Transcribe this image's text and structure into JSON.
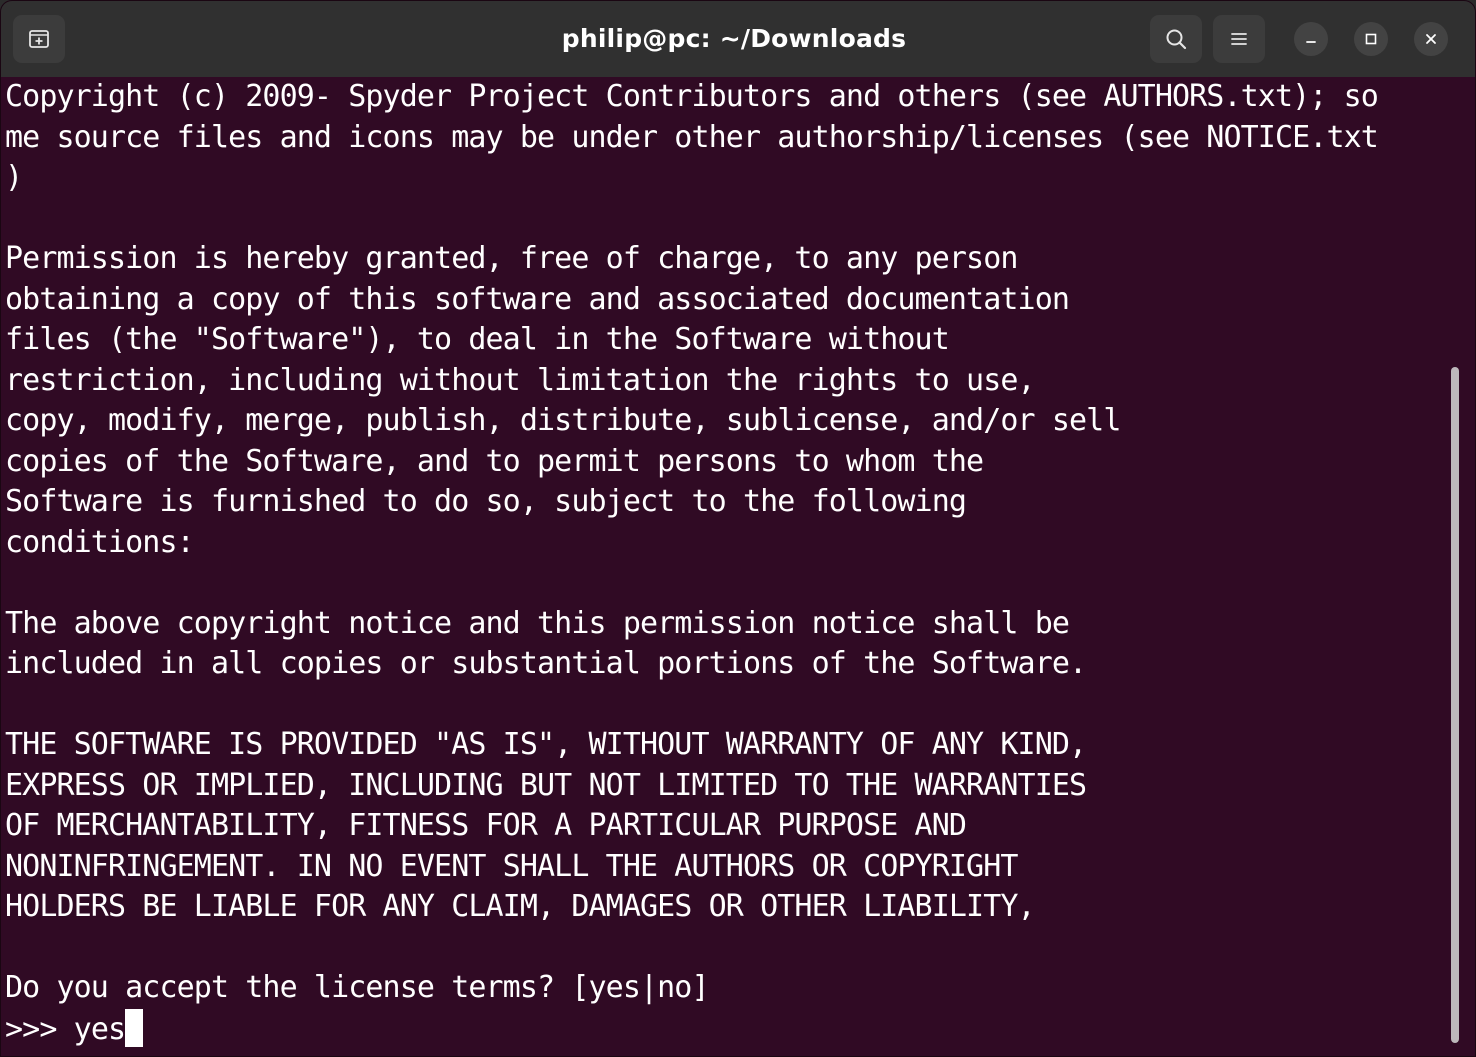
{
  "window": {
    "title": "philip@pc: ~/Downloads"
  },
  "titlebar": {
    "icons": {
      "new_tab": "new-tab-icon",
      "search": "search-icon",
      "menu": "hamburger-menu-icon",
      "minimize": "minimize-icon",
      "maximize": "maximize-icon",
      "close": "close-icon"
    }
  },
  "terminal": {
    "lines": [
      "Copyright (c) 2009- Spyder Project Contributors and others (see AUTHORS.txt); so",
      "me source files and icons may be under other authorship/licenses (see NOTICE.txt",
      ")",
      "",
      "Permission is hereby granted, free of charge, to any person",
      "obtaining a copy of this software and associated documentation",
      "files (the \"Software\"), to deal in the Software without",
      "restriction, including without limitation the rights to use,",
      "copy, modify, merge, publish, distribute, sublicense, and/or sell",
      "copies of the Software, and to permit persons to whom the",
      "Software is furnished to do so, subject to the following",
      "conditions:",
      "",
      "The above copyright notice and this permission notice shall be",
      "included in all copies or substantial portions of the Software.",
      "",
      "THE SOFTWARE IS PROVIDED \"AS IS\", WITHOUT WARRANTY OF ANY KIND,",
      "EXPRESS OR IMPLIED, INCLUDING BUT NOT LIMITED TO THE WARRANTIES",
      "OF MERCHANTABILITY, FITNESS FOR A PARTICULAR PURPOSE AND",
      "NONINFRINGEMENT. IN NO EVENT SHALL THE AUTHORS OR COPYRIGHT",
      "HOLDERS BE LIABLE FOR ANY CLAIM, DAMAGES OR OTHER LIABILITY,",
      "",
      "Do you accept the license terms? [yes|no]"
    ],
    "prompt": ">>> ",
    "input_value": "yes"
  },
  "colors": {
    "terminal_bg": "#300a24",
    "titlebar_bg": "#303030",
    "text": "#ffffff"
  }
}
